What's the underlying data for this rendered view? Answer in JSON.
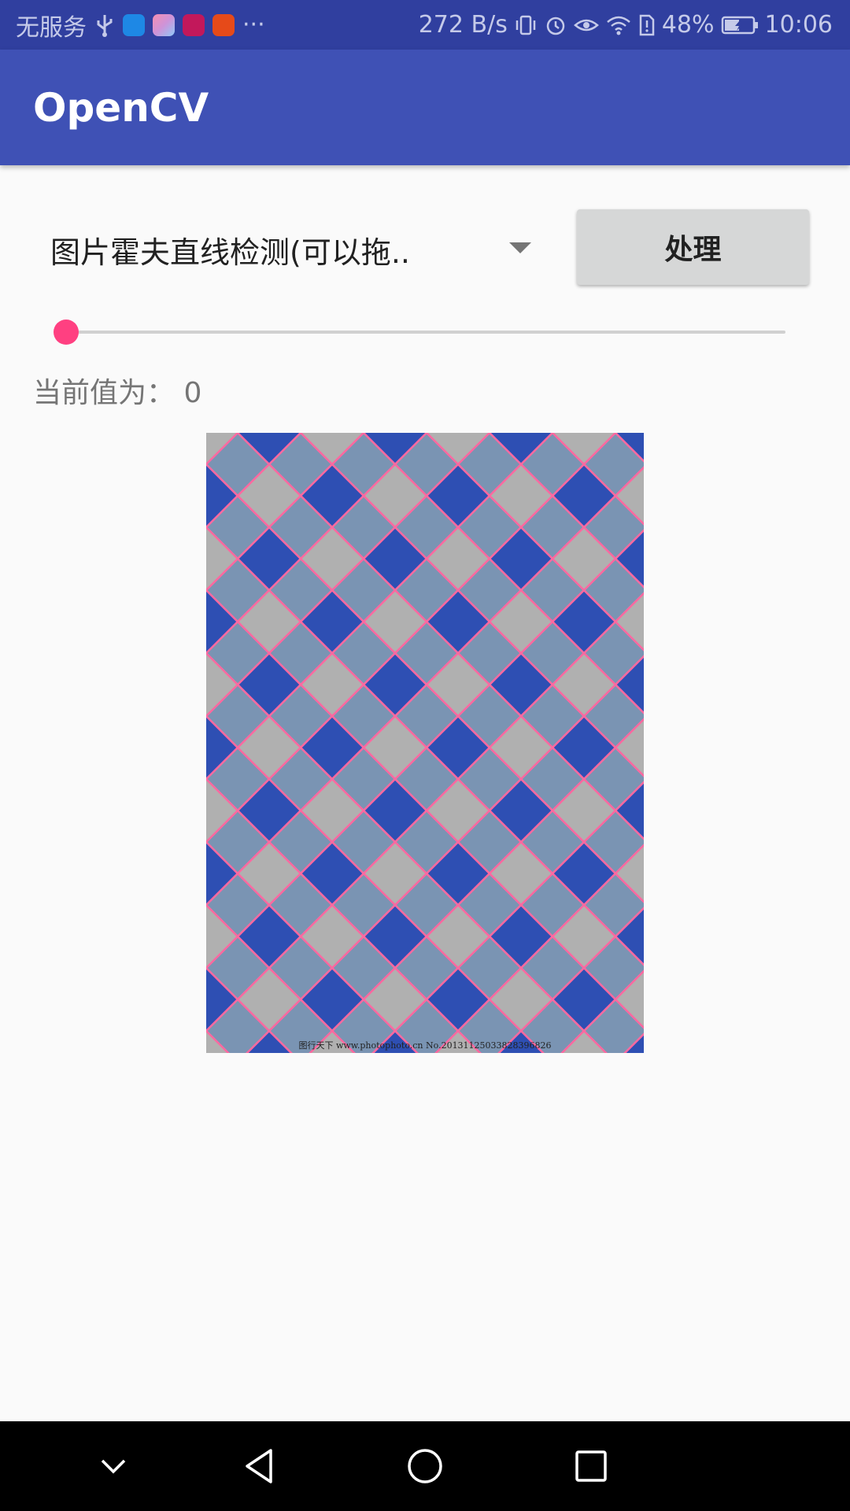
{
  "status_bar": {
    "carrier": "无服务",
    "more": "···",
    "net_speed": "272 B/s",
    "battery": "48%",
    "time": "10:06"
  },
  "app_bar": {
    "title": "OpenCV"
  },
  "spinner": {
    "selected": "图片霍夫直线检测(可以拖.."
  },
  "process_button": {
    "label": "处理"
  },
  "seekbar": {
    "value": 0
  },
  "value_label": "当前值为：  0",
  "image": {
    "watermark": "图行天下 www.photophoto.cn  No.20131125033828396826",
    "colors": {
      "dark_tile": "#2e4fb3",
      "light_tile": "#b0b0b0",
      "mid_tile": "#7a94b3",
      "line": "#ff69a0"
    }
  },
  "colors": {
    "primary": "#3f51b5",
    "primary_dark": "#303f9f",
    "accent": "#ff4081"
  }
}
